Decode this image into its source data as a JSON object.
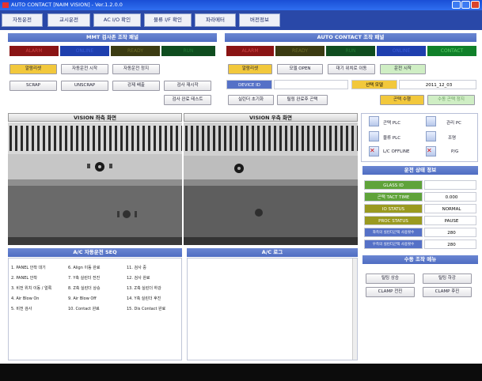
{
  "window": {
    "title": "AUTO CONTACT [NAIM VISION] - Ver.1.2.0.0"
  },
  "menu": [
    "자동운전",
    "교시운전",
    "AC I/O 확인",
    "물류 I/F 확인",
    "파라메터",
    "버전정보"
  ],
  "mmt": {
    "title": "MMT 검사존 조작 패널",
    "status": [
      "ALARM",
      "ONLINE",
      "READY",
      "RUN"
    ],
    "buttons": [
      "알람리셋",
      "자동운전 시작",
      "자동운전 정지",
      "SCRAP",
      "UNSCRAP",
      "강제 배출",
      "검사 재시작",
      "검사 완료 테스트"
    ]
  },
  "ac": {
    "title": "AUTO CONTACT 조작 패널",
    "status": [
      "ALARM",
      "READY",
      "RUN",
      "ONLINE",
      "CONTACT"
    ],
    "row1": [
      "알람리셋",
      "모델 OPEN",
      "대기 위치로 이동",
      "운전 시작"
    ],
    "device_label": "DEVICE ID",
    "device_value": "",
    "model_label": "선택 모델",
    "model_value": "2011_12_03",
    "row3": [
      "실린더 초기화",
      "릴링 완료후 곤택",
      "곤택 수행",
      "수동 곤택 정지"
    ]
  },
  "vision": {
    "left_title": "VISION 좌측 화면",
    "right_title": "VISION 우측 화면"
  },
  "comms": {
    "items": [
      "곤택 PLC",
      "관리 PC",
      "물류 PLC",
      "조명",
      "L/C OFFLINE",
      "P/G"
    ]
  },
  "run_info": {
    "title": "운전 상태 정보",
    "rows": [
      {
        "label": "GLASS ID",
        "value": ""
      },
      {
        "label": "곤택 TACT TIME",
        "value": "0.000"
      },
      {
        "label": "IO STATUS",
        "value": "NORMAL"
      },
      {
        "label": "PROC STATUS",
        "value": "PAUSE"
      },
      {
        "label": "좌측의 실린더곤택 사용횟수",
        "value": "280"
      },
      {
        "label": "우측의 실린더곤택 사용횟수",
        "value": "280"
      }
    ]
  },
  "manual": {
    "title": "수동 조작 메뉴",
    "buttons": [
      "틸팅 상승",
      "틸팅 하강",
      "CLAMP 전진",
      "CLAMP 후진"
    ]
  },
  "seq": {
    "title": "A/C 자동운전 SEQ",
    "col1": [
      "1. PANEL 안착 대기",
      "2. PANEL 안착",
      "3. 비전 위치 이동 / 얼록",
      "4. Air Blow On",
      "5. 비전 검사"
    ],
    "col2": [
      "6. Align 이동 완료",
      "7. Y축 실린더 전진",
      "8. Z축 실린더 상승",
      "9. Air Blow Off",
      "10. Contact 완료"
    ],
    "col3": [
      "11. 검사 중",
      "12. 검사 완료",
      "13. Z축 실린더 하강",
      "14. Y축 실린더 후진",
      "15. Dis Contact 완료"
    ]
  },
  "log": {
    "title": "A/C 로그"
  },
  "colors": {
    "alarm": "#8a1414",
    "online": "#1e3fae",
    "ready": "#3b3b12",
    "run": "#0f4d1f",
    "contact": "#10802a",
    "yellow": "#f2c83c",
    "green_btn": "#cfeec4",
    "label_green": "#5fa33a"
  }
}
